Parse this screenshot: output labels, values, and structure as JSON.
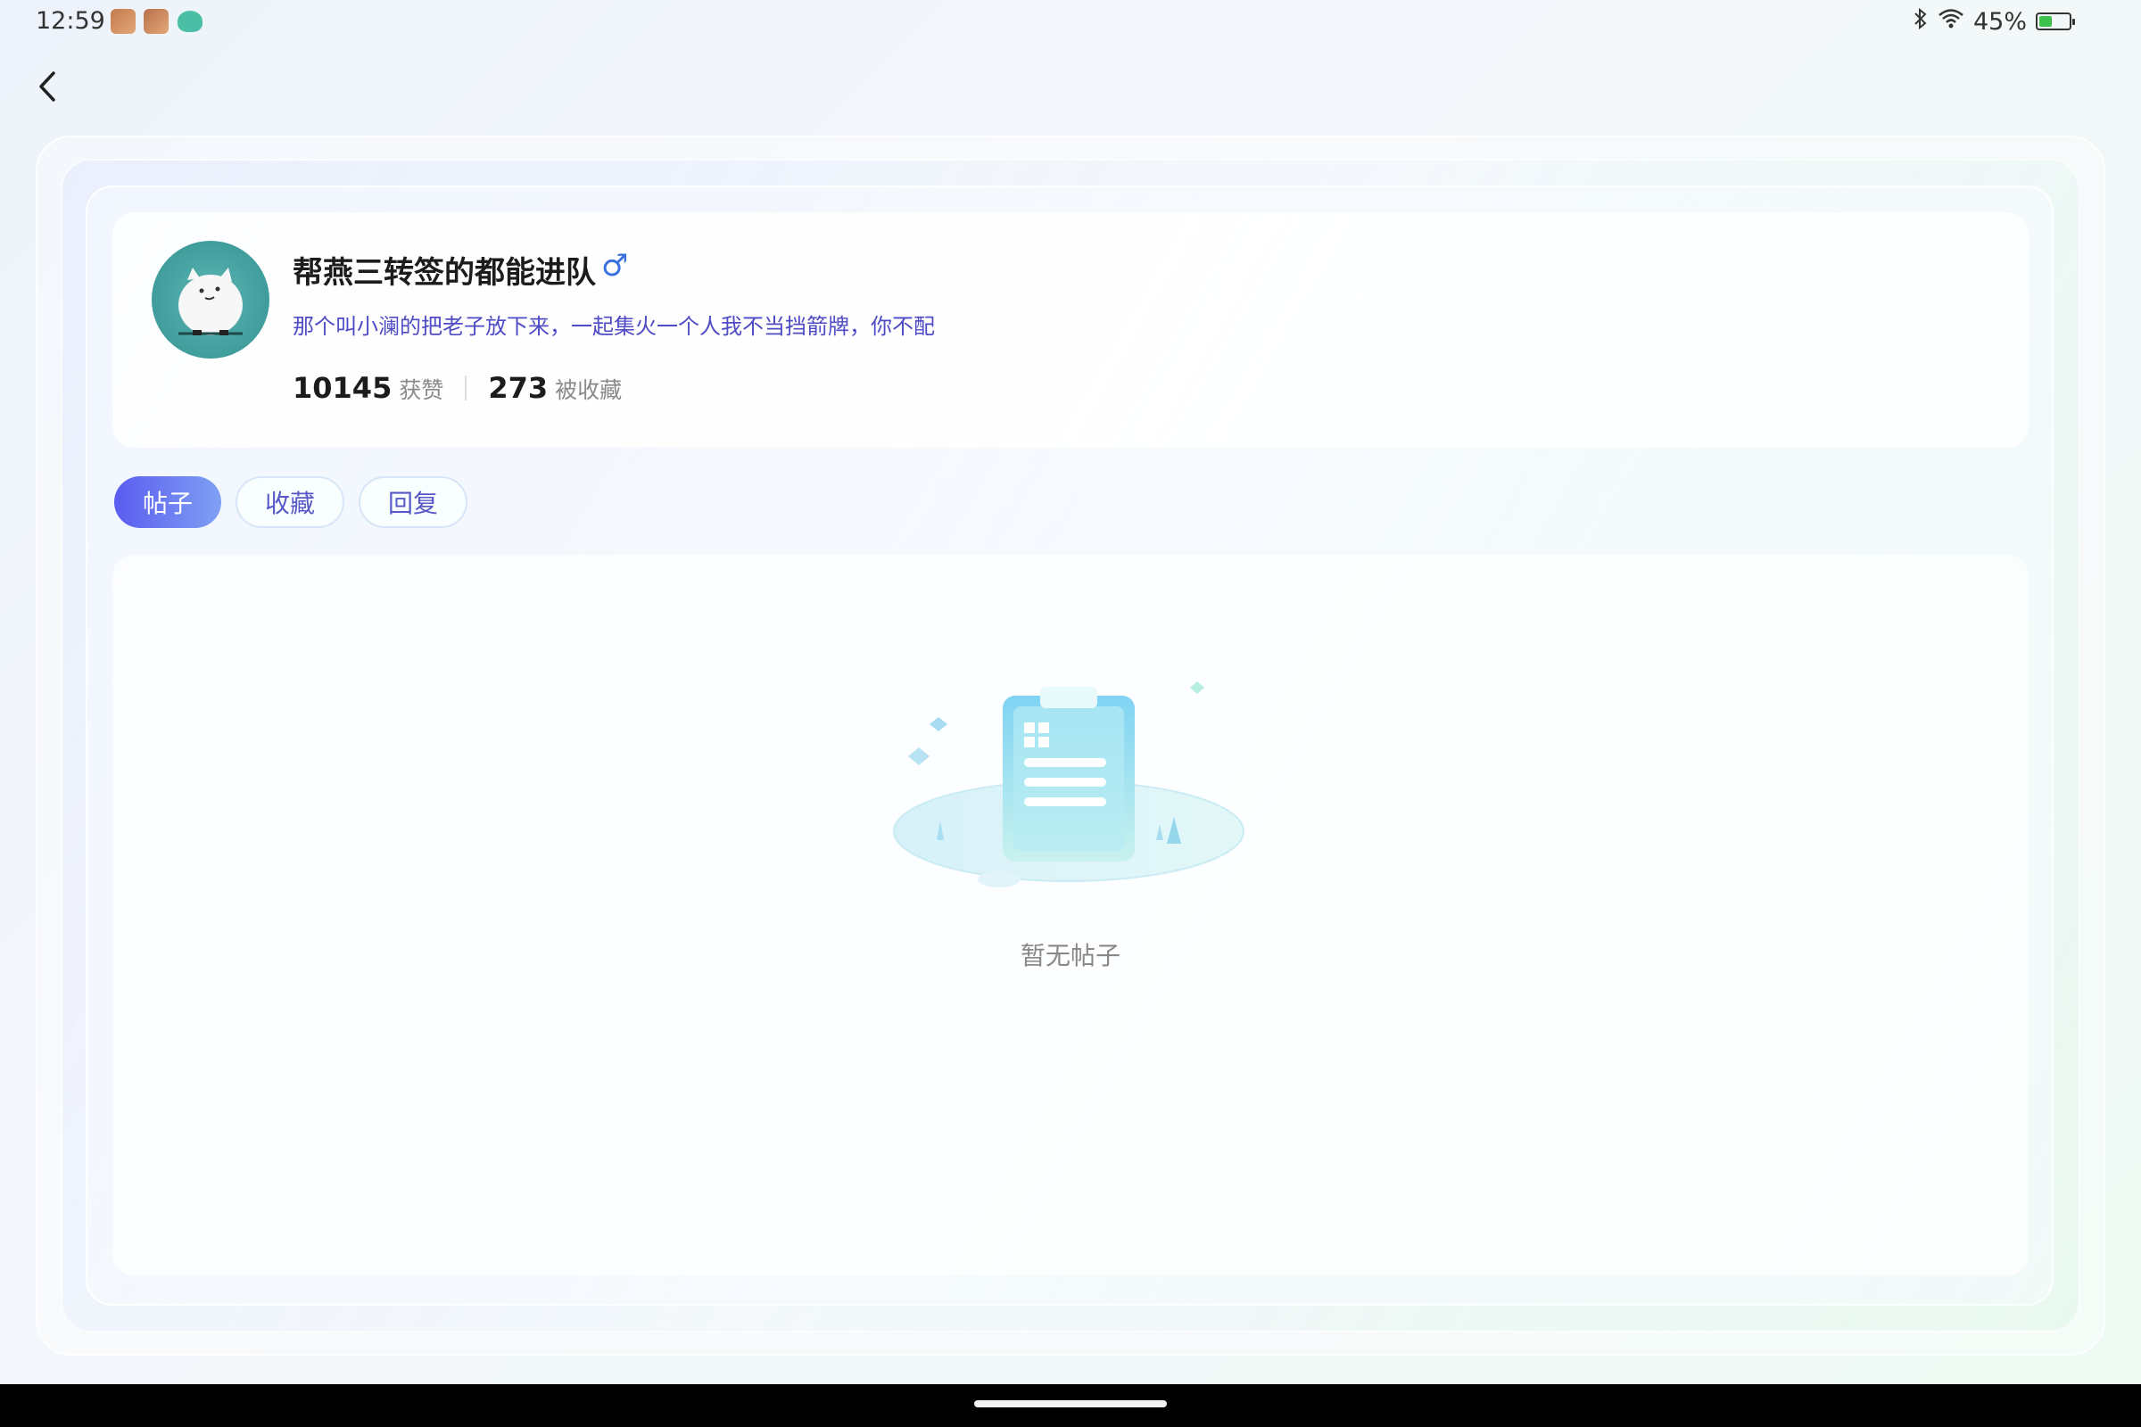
{
  "status_bar": {
    "time": "12:59",
    "battery": "45%",
    "battery_level": 0.45
  },
  "profile": {
    "username": "帮燕三转签的都能进队",
    "gender_symbol": "♂",
    "bio": "那个叫小澜的把老子放下来，一起集火一个人我不当挡箭牌，你不配",
    "likes_count": "10145",
    "likes_label": "获赞",
    "favorited_count": "273",
    "favorited_label": "被收藏"
  },
  "tabs": [
    {
      "label": "帖子",
      "active": true
    },
    {
      "label": "收藏",
      "active": false
    },
    {
      "label": "回复",
      "active": false
    }
  ],
  "content": {
    "empty_text": "暂无帖子"
  },
  "colors": {
    "accent": "#5a5cf0",
    "bio_text": "#4e4bc4",
    "gender": "#3a6fe0"
  }
}
